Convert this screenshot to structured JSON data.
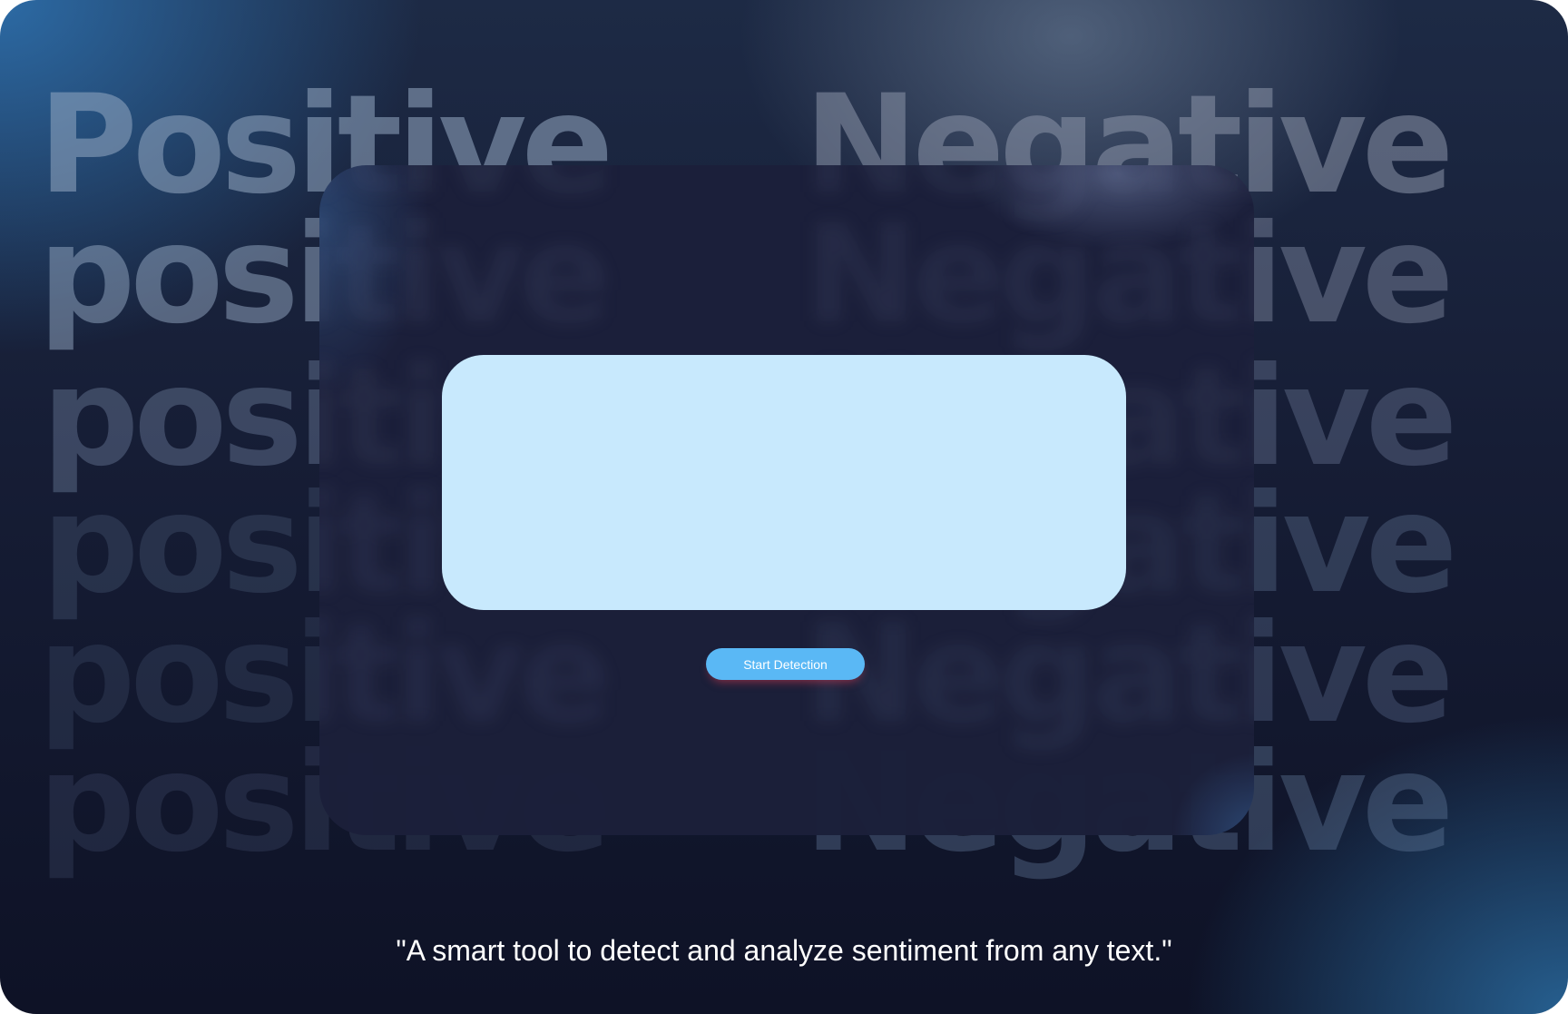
{
  "background": {
    "words_left": [
      "Positive",
      "positive",
      "positive",
      "positive",
      "positive",
      "positive"
    ],
    "words_right": [
      "Negative",
      "Negative",
      "Negative",
      "Negative",
      "Negative",
      "Negative"
    ]
  },
  "input": {
    "value": "",
    "placeholder": ""
  },
  "actions": {
    "start_label": "Start Detection"
  },
  "tagline": "\"A smart tool to detect and analyze sentiment from any text.\"",
  "colors": {
    "panel": "#1b1f3a",
    "input_background": "#c8e9fd",
    "button": "#5ab8f5",
    "text": "#ffffff"
  }
}
